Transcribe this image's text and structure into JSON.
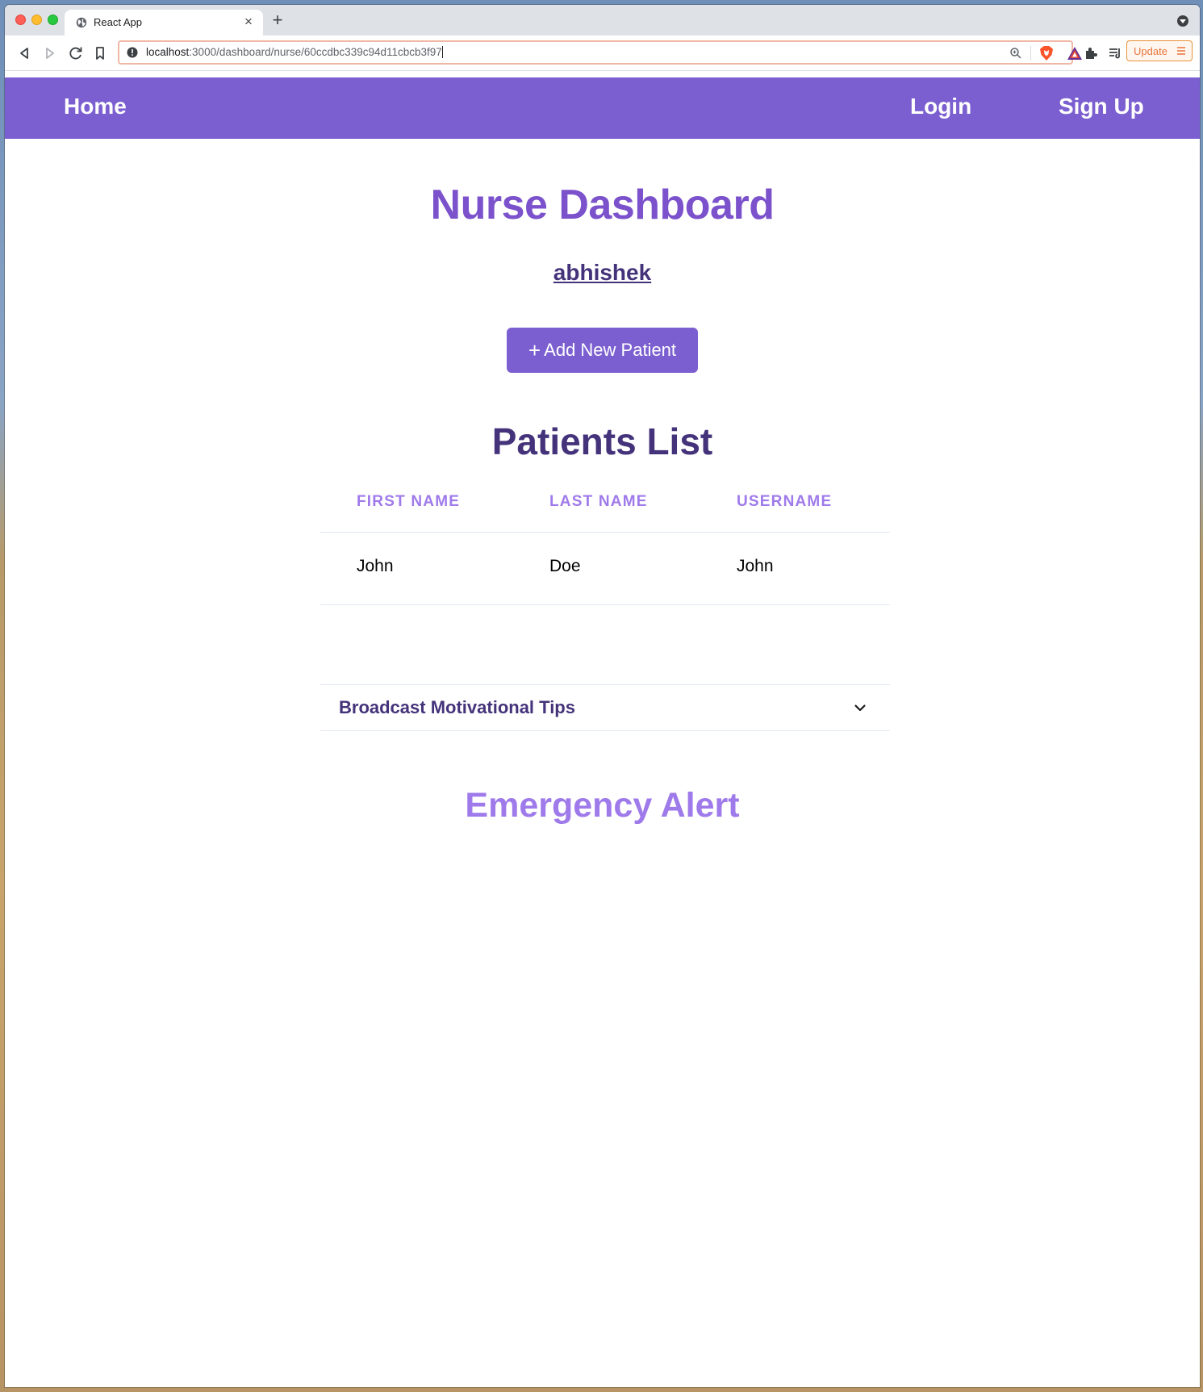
{
  "browser": {
    "tab_title": "React App",
    "url_host": "localhost",
    "url_path": ":3000/dashboard/nurse/60ccdbc339c94d11cbcb3f97",
    "update_label": "Update"
  },
  "navbar": {
    "home": "Home",
    "login": "Login",
    "signup": "Sign Up",
    "bg_color": "#7b5fd0"
  },
  "dashboard": {
    "title": "Nurse Dashboard",
    "nurse_name": "abhishek",
    "add_button_label": "Add New Patient",
    "add_button_icon": "plus-icon"
  },
  "patients": {
    "title": "Patients List",
    "columns": [
      "FIRST NAME",
      "LAST NAME",
      "USERNAME"
    ],
    "rows": [
      {
        "first_name": "John",
        "last_name": "Doe",
        "username": "John"
      }
    ]
  },
  "broadcast": {
    "label": "Broadcast Motivational Tips",
    "icon": "chevron-down-icon"
  },
  "emergency": {
    "title": "Emergency Alert"
  },
  "colors": {
    "accent": "#7b5fd0",
    "title_purple": "#7b52cc",
    "dark_purple": "#44337a",
    "light_purple": "#9f7aea"
  }
}
